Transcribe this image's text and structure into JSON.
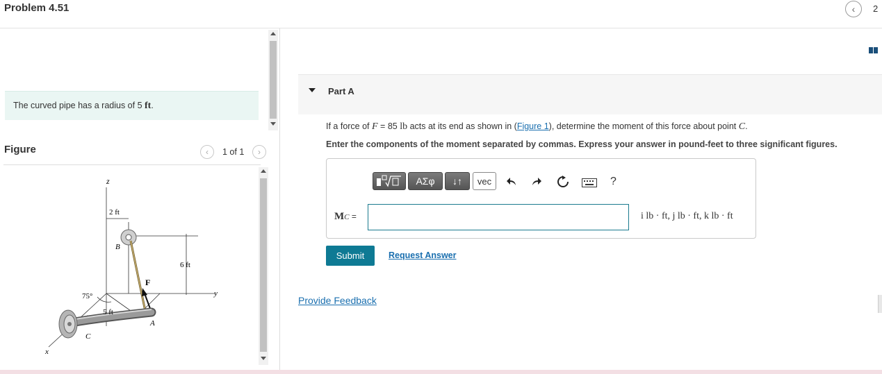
{
  "header": {
    "title": "Problem 4.51",
    "nav_prev": "‹",
    "page_fragment": "2"
  },
  "intro": {
    "text_before": "The curved pipe has a radius of 5 ",
    "unit": "ft",
    "text_after": "."
  },
  "figure": {
    "label": "Figure",
    "pager": "1 of 1",
    "labels": {
      "z": "z",
      "dim_2ft": "2 ft",
      "B": "B",
      "dim_6ft": "6 ft",
      "F": "F",
      "angle": "75°",
      "y": "y",
      "dim_5ft": "5 ft",
      "A": "A",
      "C": "C",
      "x": "x"
    }
  },
  "part_a": {
    "label": "Part A",
    "question": {
      "p1": "If a force of ",
      "F": "F",
      "p2": " = 85 ",
      "lb": "lb",
      "p3": " acts at its end as shown in (",
      "link": "Figure 1",
      "p4": "), determine the moment of this force about point ",
      "C": "C",
      "p5": "."
    },
    "instructions": "Enter the components of the moment separated by commas. Express your answer in pound-feet to three significant figures.",
    "toolbar": {
      "greek": "ΑΣφ",
      "sort": "↓↑",
      "vec": "vec",
      "help": "?"
    },
    "answer_label_main": "M",
    "answer_label_sub": "C",
    "answer_label_eq": " =",
    "input_value": "",
    "units": "i lb · ft, j lb · ft, k lb · ft",
    "submit": "Submit",
    "request_answer": "Request Answer"
  },
  "feedback": "Provide Feedback"
}
